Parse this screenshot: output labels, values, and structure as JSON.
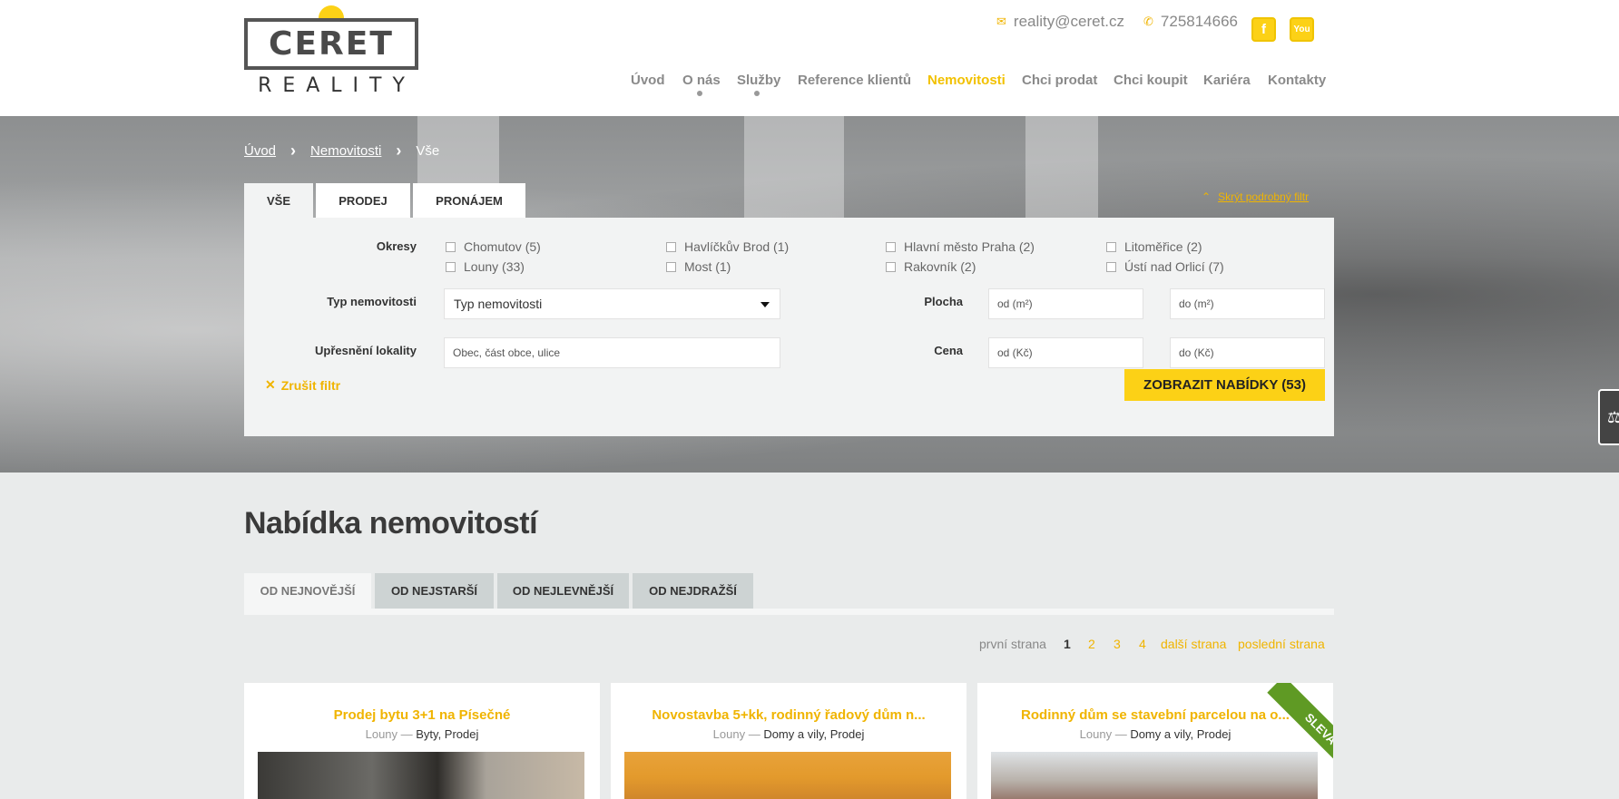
{
  "logo": {
    "brand": "CERET",
    "subtitle": "REALITY"
  },
  "contact": {
    "email": "reality@ceret.cz",
    "phone": "725814666",
    "facebook_icon": "facebook-icon",
    "youtube_icon": "youtube-icon"
  },
  "nav": [
    "Úvod",
    "O nás",
    "Služby",
    "Reference klientů",
    "Nemovitosti",
    "Chci prodat",
    "Chci koupit",
    "Kariéra",
    "Kontakty"
  ],
  "breadcrumb": [
    "Úvod",
    "Nemovitosti",
    "Vše"
  ],
  "filter_tabs": [
    "VŠE",
    "PRODEJ",
    "PRONÁJEM"
  ],
  "hide_filter": "Skrýt podrobný filtr",
  "filter": {
    "okresy_label": "Okresy",
    "okresy": [
      "Chomutov (5)",
      "Havlíčkův Brod (1)",
      "Hlavní město Praha (2)",
      "Litoměřice (2)",
      "Louny (33)",
      "Most (1)",
      "Rakovník (2)",
      "Ústí nad Orlicí (7)"
    ],
    "typ_label": "Typ nemovitosti",
    "typ_value": "Typ nemovitosti",
    "lokalita_label": "Upřesnění lokality",
    "lokalita_placeholder": "Obec, část obce, ulice",
    "plocha_label": "Plocha",
    "plocha_od": "od (m²)",
    "plocha_do": "do (m²)",
    "cena_label": "Cena",
    "cena_od": "od (Kč)",
    "cena_do": "do (Kč)",
    "reset": "Zrušit filtr",
    "submit": "ZOBRAZIT NABÍDKY (53)"
  },
  "listing": {
    "title": "Nabídka nemovitostí",
    "sort": [
      "OD NEJNOVĚJŠÍ",
      "OD NEJSTARŠÍ",
      "OD NEJLEVNĚJŠÍ",
      "OD NEJDRAŽŠÍ"
    ],
    "pager": {
      "first": "první strana",
      "pages": [
        "1",
        "2",
        "3",
        "4"
      ],
      "next": "další strana",
      "last": "poslední strana"
    },
    "cards": [
      {
        "title": "Prodej bytu 3+1 na Písečné",
        "place": "Louny",
        "dash": " — ",
        "category": "Byty, Prodej"
      },
      {
        "title": "Novostavba 5+kk, rodinný řadový dům n...",
        "place": "Louny",
        "dash": " — ",
        "category": "Domy a vily, Prodej"
      },
      {
        "title": "Rodinný dům se stavební parcelou na o...",
        "place": "Louny",
        "dash": " — ",
        "category": "Domy a vily, Prodej",
        "badge": "SLEVA"
      }
    ]
  },
  "colors": {
    "accent": "#f0b400",
    "button": "#fcd116",
    "ribbon": "#5f9a24"
  }
}
